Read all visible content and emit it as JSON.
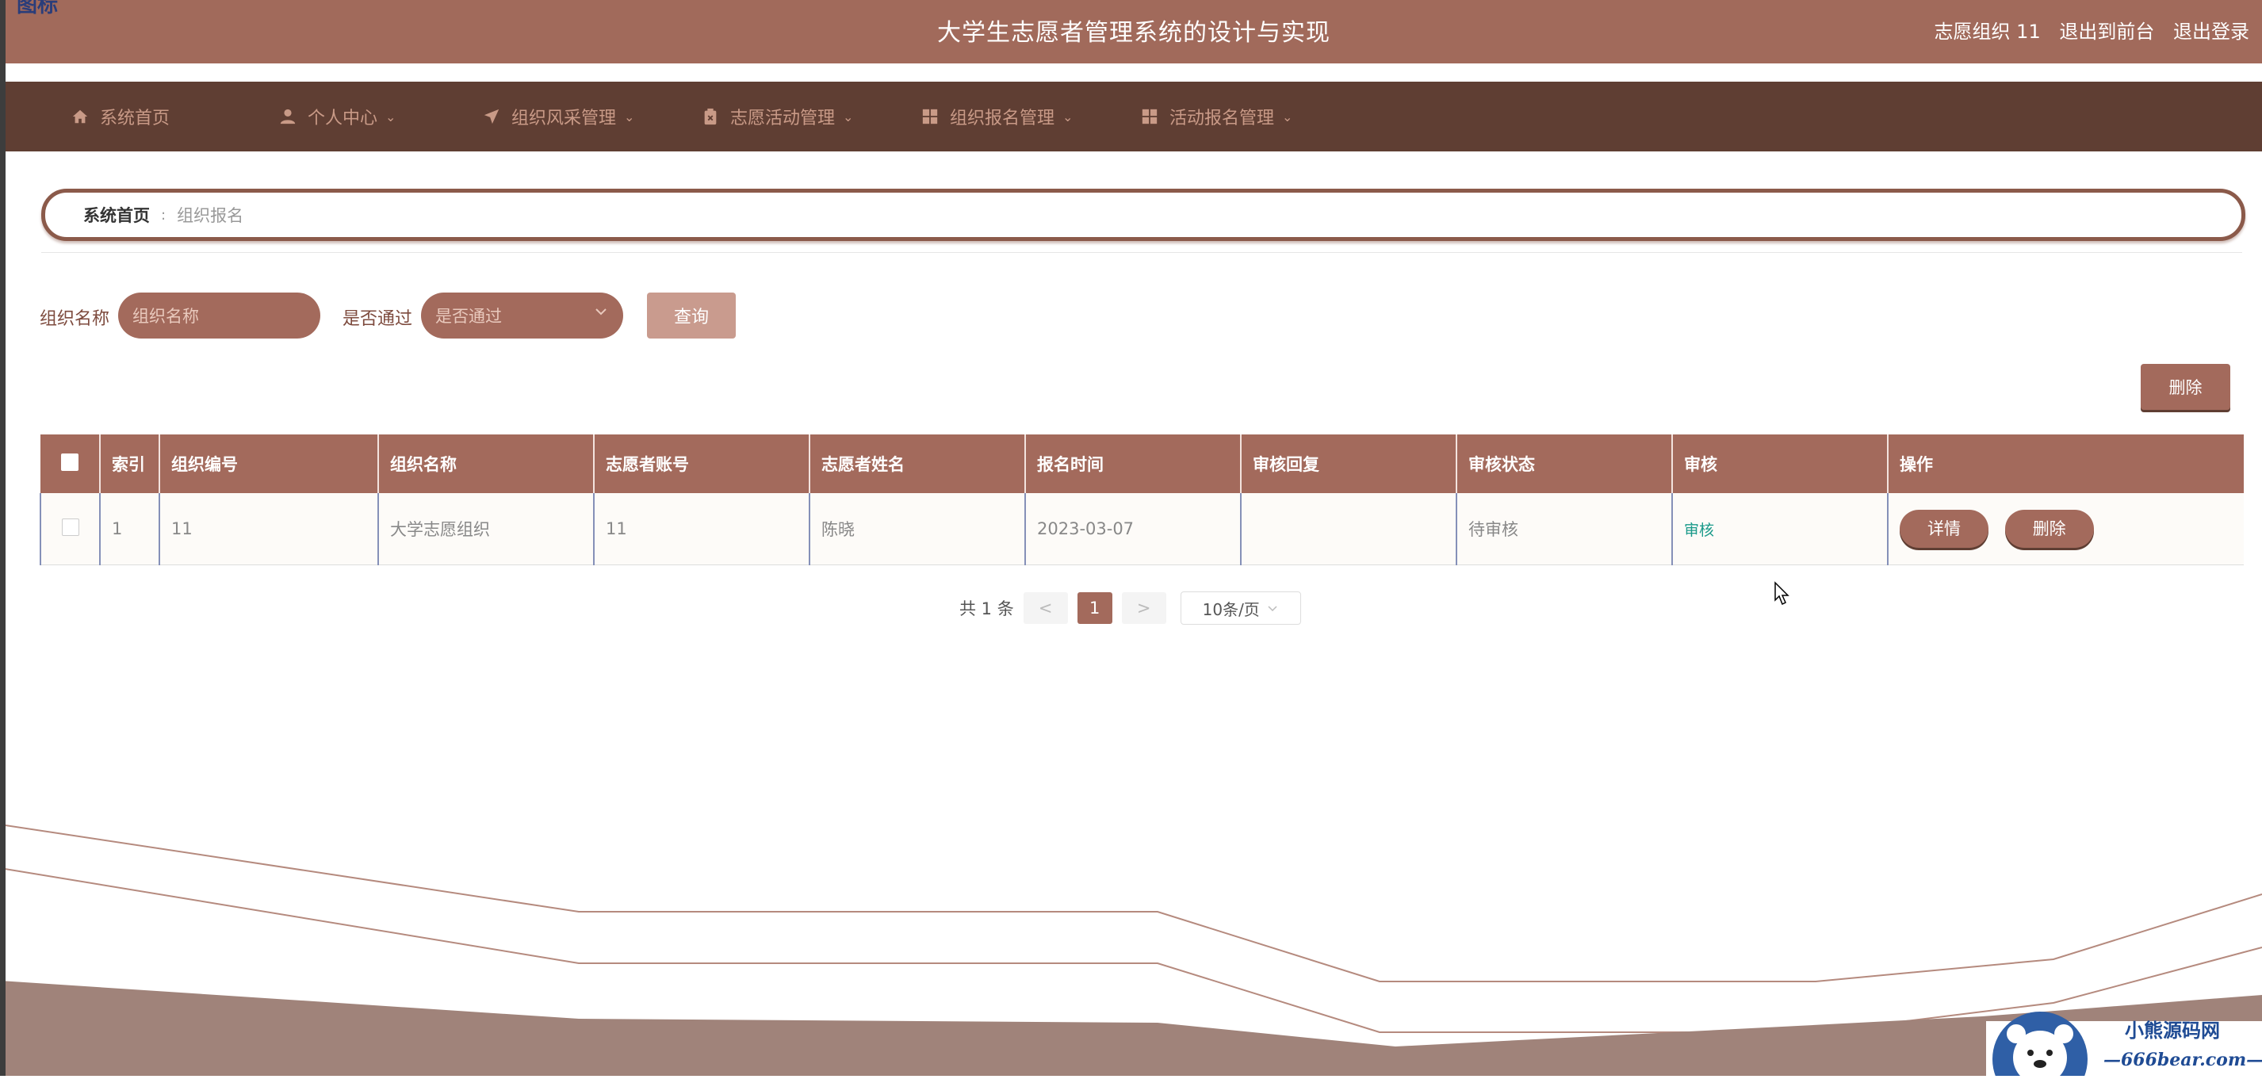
{
  "header": {
    "corner_text": "图标",
    "title": "大学生志愿者管理系统的设计与实现",
    "user": "志愿组织 11",
    "to_front": "退出到前台",
    "logout": "退出登录"
  },
  "nav": [
    {
      "label": "系统首页",
      "icon": "home-icon"
    },
    {
      "label": "个人中心",
      "icon": "user-icon"
    },
    {
      "label": "组织风采管理",
      "icon": "send-icon"
    },
    {
      "label": "志愿活动管理",
      "icon": "clipboard-icon"
    },
    {
      "label": "组织报名管理",
      "icon": "grid-icon"
    },
    {
      "label": "活动报名管理",
      "icon": "grid-icon"
    }
  ],
  "breadcrumb": {
    "home": "系统首页",
    "separator": ":",
    "current": "组织报名"
  },
  "search": {
    "name_label": "组织名称",
    "name_placeholder": "组织名称",
    "pass_label": "是否通过",
    "pass_placeholder": "是否通过",
    "query_button": "查询"
  },
  "toolbar": {
    "delete_button": "删除"
  },
  "table": {
    "columns": [
      "索引",
      "组织编号",
      "组织名称",
      "志愿者账号",
      "志愿者姓名",
      "报名时间",
      "审核回复",
      "审核状态",
      "审核",
      "操作"
    ],
    "rows": [
      {
        "index": "1",
        "org_no": "11",
        "org_name": "大学志愿组织",
        "account": "11",
        "name": "陈晓",
        "time": "2023-03-07",
        "reply": "",
        "status": "待审核",
        "audit": "审核",
        "detail": "详情",
        "delete": "删除"
      }
    ]
  },
  "pagination": {
    "total": "共 1 条",
    "prev": "<",
    "page": "1",
    "next": ">",
    "page_size": "10条/页"
  },
  "watermark": {
    "title": "小熊源码网",
    "url": "—666bear.com—"
  },
  "colors": {
    "primary": "#a36a5c",
    "dark": "#5f3e33",
    "link": "#1a9a8a"
  }
}
